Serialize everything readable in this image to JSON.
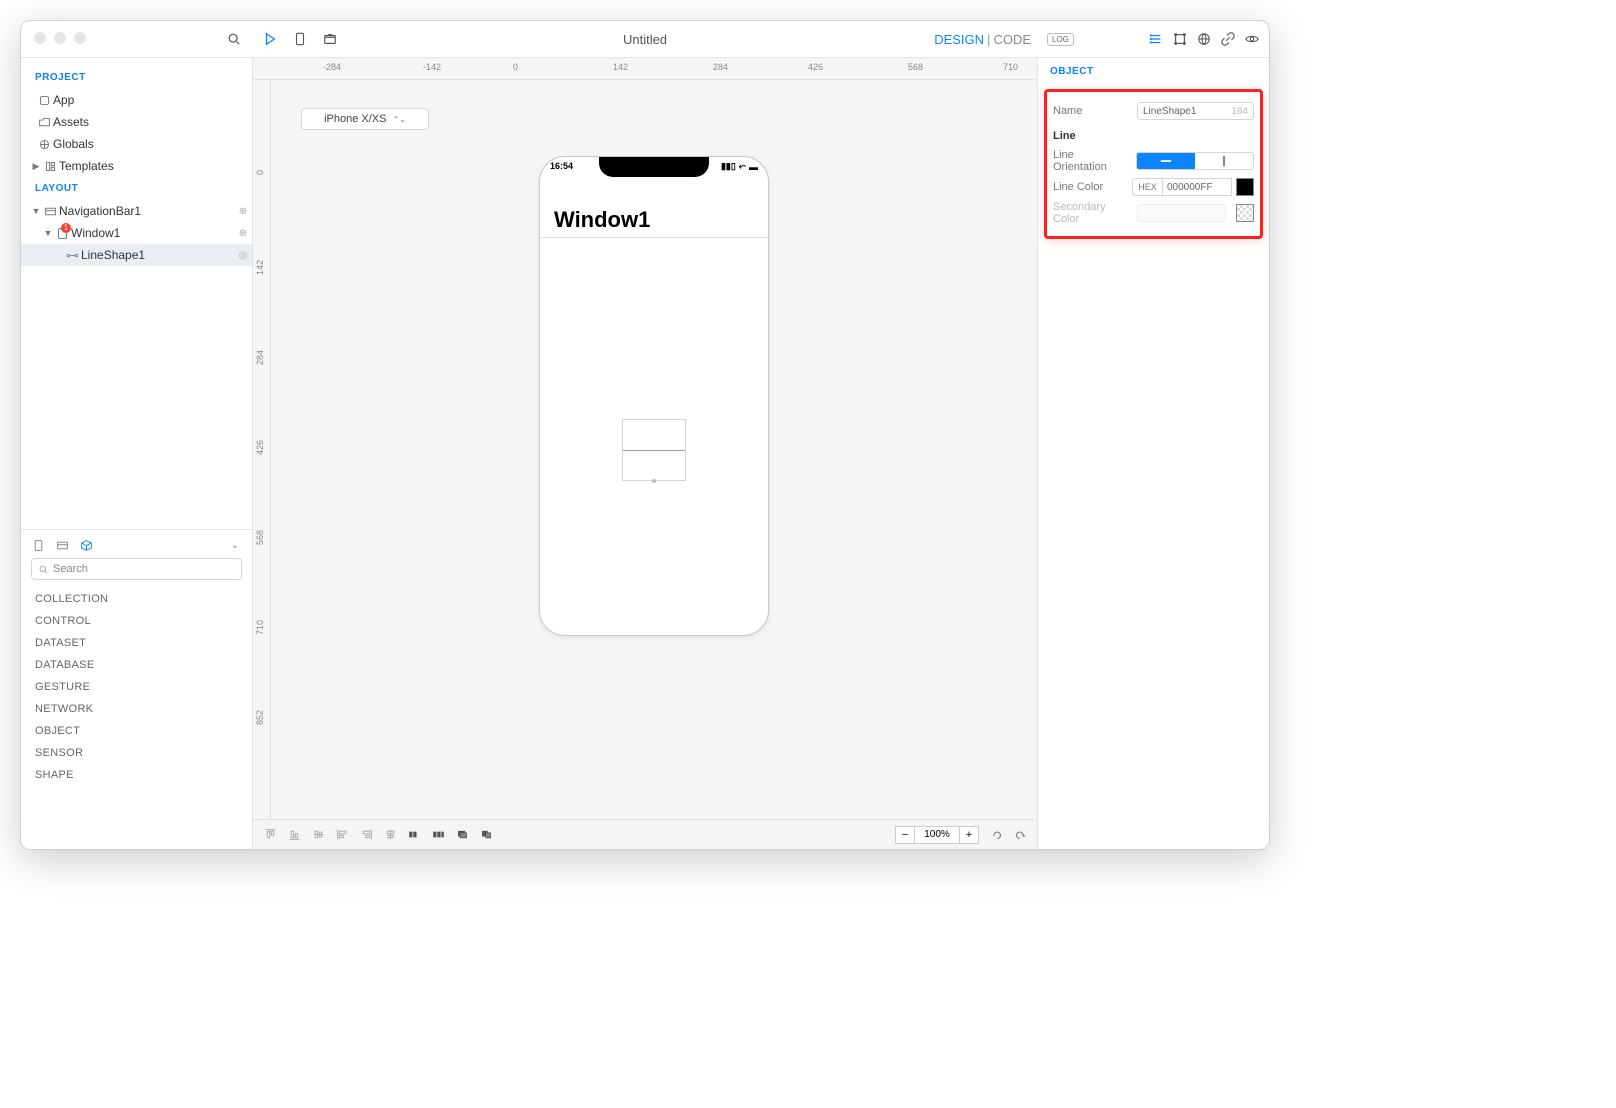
{
  "title": "Untitled",
  "mode": {
    "design": "DESIGN",
    "code": "CODE"
  },
  "ruler_h": [
    "-284",
    "-142",
    "0",
    "142",
    "284",
    "426",
    "568",
    "710"
  ],
  "ruler_v": [
    "0",
    "142",
    "284",
    "426",
    "568",
    "710",
    "852"
  ],
  "left": {
    "project_hdr": "PROJECT",
    "project": [
      "App",
      "Assets",
      "Globals",
      "Templates"
    ],
    "layout_hdr": "LAYOUT",
    "layout": {
      "nav": "NavigationBar1",
      "window": "Window1",
      "line": "LineShape1"
    },
    "library": {
      "search": "Search",
      "cats": [
        "COLLECTION",
        "CONTROL",
        "DATASET",
        "DATABASE",
        "GESTURE",
        "NETWORK",
        "OBJECT",
        "SENSOR",
        "SHAPE"
      ]
    }
  },
  "device_selector": "iPhone X/XS",
  "phone": {
    "time": "16:54",
    "title": "Window1"
  },
  "zoom": "100%",
  "inspector": {
    "hdr": "OBJECT",
    "name_lbl": "Name",
    "name_val": "LineShape1",
    "name_num": "184",
    "section": "Line",
    "orient_lbl": "Line Orientation",
    "color_lbl": "Line Color",
    "hex_lbl": "HEX",
    "hex_val": "000000FF",
    "sec_lbl": "Secondary Color"
  }
}
